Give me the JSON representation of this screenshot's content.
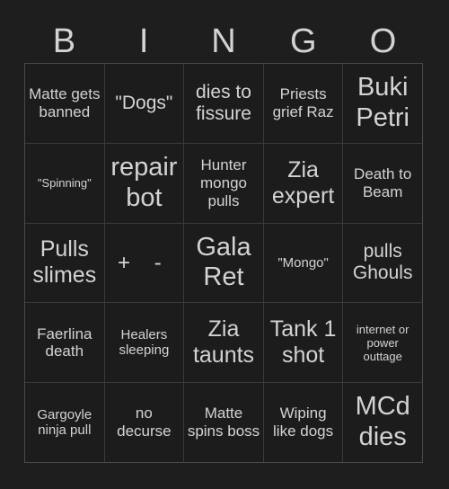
{
  "card": {
    "title": "BINGO",
    "header_letters": [
      "B",
      "I",
      "N",
      "G",
      "O"
    ],
    "colors": {
      "page_background": "#1e1e1e",
      "cell_background": "#1c1c1c",
      "grid_line": "#3a3a3a",
      "text": "#d3d3d3"
    },
    "grid_size": "5x5",
    "cells": [
      {
        "text": "Matte gets banned",
        "size": "m",
        "free": false
      },
      {
        "text": "\"Dogs\"",
        "size": "l",
        "free": false
      },
      {
        "text": "dies to fissure",
        "size": "l",
        "free": false
      },
      {
        "text": "Priests grief Raz",
        "size": "m",
        "free": false
      },
      {
        "text": "Buki Petri",
        "size": "xxl",
        "free": false
      },
      {
        "text": "\"Spinning\"",
        "size": "xs",
        "free": false
      },
      {
        "text": "repair bot",
        "size": "xxl",
        "free": false
      },
      {
        "text": "Hunter mongo pulls",
        "size": "m",
        "free": false
      },
      {
        "text": "Zia expert",
        "size": "xl",
        "free": false
      },
      {
        "text": "Death to Beam",
        "size": "m",
        "free": false
      },
      {
        "text": "Pulls slimes",
        "size": "xl",
        "free": false
      },
      {
        "text": "+ -",
        "size": "xl",
        "free": true
      },
      {
        "text": "Gala Ret",
        "size": "xxl",
        "free": false
      },
      {
        "text": "\"Mongo\"",
        "size": "s",
        "free": false
      },
      {
        "text": "pulls Ghouls",
        "size": "l",
        "free": false
      },
      {
        "text": "Faerlina death",
        "size": "m",
        "free": false
      },
      {
        "text": "Healers sleeping",
        "size": "s",
        "free": false
      },
      {
        "text": "Zia taunts",
        "size": "xl",
        "free": false
      },
      {
        "text": "Tank 1 shot",
        "size": "xl",
        "free": false
      },
      {
        "text": "internet or power outtage",
        "size": "xs",
        "free": false
      },
      {
        "text": "Gargoyle ninja pull",
        "size": "s",
        "free": false
      },
      {
        "text": "no decurse",
        "size": "m",
        "free": false
      },
      {
        "text": "Matte spins boss",
        "size": "m",
        "free": false
      },
      {
        "text": "Wiping like dogs",
        "size": "m",
        "free": false
      },
      {
        "text": "MCd dies",
        "size": "xxl",
        "free": false
      }
    ]
  }
}
